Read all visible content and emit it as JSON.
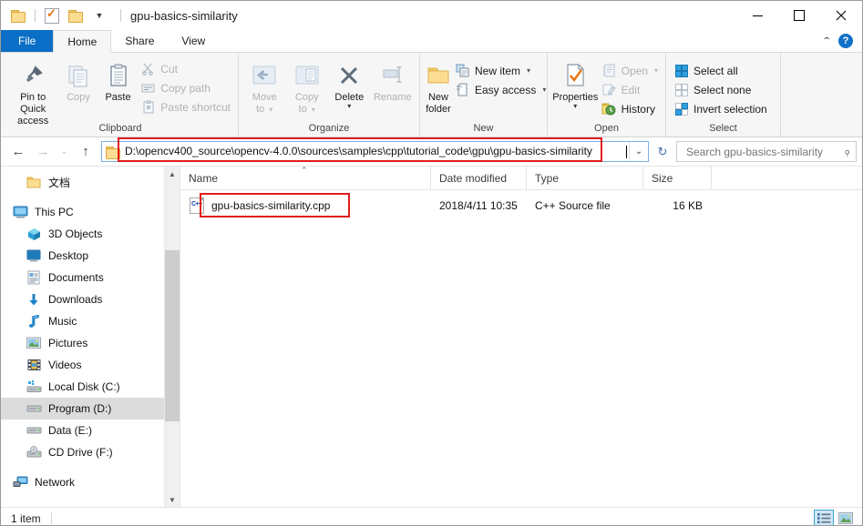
{
  "window": {
    "title": "gpu-basics-similarity",
    "controls": {
      "minimize": "–",
      "maximize": "□",
      "close": "✕"
    }
  },
  "quick_access": {
    "items": [
      "folder-icon",
      "properties-icon",
      "new-folder-icon",
      "customize-caret"
    ]
  },
  "tabs": [
    {
      "label": "File",
      "active": false,
      "type": "file"
    },
    {
      "label": "Home",
      "active": true,
      "type": "normal"
    },
    {
      "label": "Share",
      "active": false,
      "type": "normal"
    },
    {
      "label": "View",
      "active": false,
      "type": "normal"
    }
  ],
  "ribbon": {
    "collapse_icon": "chevron-up-icon",
    "help_icon": "?",
    "groups": [
      {
        "label": "Clipboard",
        "big": [
          {
            "label": "Pin to Quick access",
            "icon": "pin-icon",
            "dim": false
          },
          {
            "label": "Copy",
            "icon": "copy-icon",
            "dim": true
          },
          {
            "label": "Paste",
            "icon": "paste-icon",
            "dim": false
          }
        ],
        "small": [
          {
            "label": "Cut",
            "icon": "scissors-icon",
            "dim": true
          },
          {
            "label": "Copy path",
            "icon": "copy-path-icon",
            "dim": true
          },
          {
            "label": "Paste shortcut",
            "icon": "paste-shortcut-icon",
            "dim": true
          }
        ]
      },
      {
        "label": "Organize",
        "big": [
          {
            "label": "Move to",
            "icon": "move-to-icon",
            "dim": true,
            "caret": true
          },
          {
            "label": "Copy to",
            "icon": "copy-to-icon",
            "dim": true,
            "caret": true
          },
          {
            "label": "Delete",
            "icon": "delete-icon",
            "dim": false,
            "caret": true
          },
          {
            "label": "Rename",
            "icon": "rename-icon",
            "dim": true
          }
        ],
        "small": []
      },
      {
        "label": "New",
        "big": [
          {
            "label": "New folder",
            "icon": "new-folder-icon",
            "dim": false
          }
        ],
        "small": [
          {
            "label": "New item",
            "icon": "new-item-icon",
            "dim": false,
            "caret": true
          },
          {
            "label": "Easy access",
            "icon": "easy-access-icon",
            "dim": false,
            "caret": true
          }
        ]
      },
      {
        "label": "Open",
        "big": [
          {
            "label": "Properties",
            "icon": "properties-icon",
            "dim": false,
            "caret": true
          }
        ],
        "small": [
          {
            "label": "Open",
            "icon": "open-icon",
            "dim": true,
            "caret": true
          },
          {
            "label": "Edit",
            "icon": "edit-icon",
            "dim": true
          },
          {
            "label": "History",
            "icon": "history-icon",
            "dim": false
          }
        ]
      },
      {
        "label": "Select",
        "big": [],
        "small": [
          {
            "label": "Select all",
            "icon": "select-all-icon",
            "dim": false
          },
          {
            "label": "Select none",
            "icon": "select-none-icon",
            "dim": false
          },
          {
            "label": "Invert selection",
            "icon": "invert-selection-icon",
            "dim": false
          }
        ]
      }
    ]
  },
  "address_bar": {
    "back_icon": "←",
    "forward_icon": "→",
    "recent_icon": "⌄",
    "up_icon": "↑",
    "path": "D:\\opencv400_source\\opencv-4.0.0\\sources\\samples\\cpp\\tutorial_code\\gpu\\gpu-basics-similarity",
    "dropdown_icon": "⌄",
    "refresh_icon": "↻"
  },
  "search": {
    "placeholder": "Search gpu-basics-similarity",
    "value": "",
    "icon": "search-icon"
  },
  "sidebar": {
    "items": [
      {
        "label": "文档",
        "icon": "folder-icon",
        "indent": 1,
        "selected": false,
        "gap_after": true
      },
      {
        "label": "This PC",
        "icon": "this-pc-icon",
        "indent": 0,
        "selected": false
      },
      {
        "label": "3D Objects",
        "icon": "3d-objects-icon",
        "indent": 1,
        "selected": false
      },
      {
        "label": "Desktop",
        "icon": "desktop-icon",
        "indent": 1,
        "selected": false
      },
      {
        "label": "Documents",
        "icon": "documents-icon",
        "indent": 1,
        "selected": false
      },
      {
        "label": "Downloads",
        "icon": "downloads-icon",
        "indent": 1,
        "selected": false
      },
      {
        "label": "Music",
        "icon": "music-icon",
        "indent": 1,
        "selected": false
      },
      {
        "label": "Pictures",
        "icon": "pictures-icon",
        "indent": 1,
        "selected": false
      },
      {
        "label": "Videos",
        "icon": "videos-icon",
        "indent": 1,
        "selected": false
      },
      {
        "label": "Local Disk (C:)",
        "icon": "local-disk-icon",
        "indent": 1,
        "selected": false
      },
      {
        "label": "Program (D:)",
        "icon": "drive-icon",
        "indent": 1,
        "selected": true
      },
      {
        "label": "Data (E:)",
        "icon": "drive-icon",
        "indent": 1,
        "selected": false
      },
      {
        "label": "CD Drive (F:)",
        "icon": "cd-drive-icon",
        "indent": 1,
        "selected": false,
        "gap_after": true
      },
      {
        "label": "Network",
        "icon": "network-icon",
        "indent": 0,
        "selected": false
      }
    ]
  },
  "file_list": {
    "columns": [
      "Name",
      "Date modified",
      "Type",
      "Size"
    ],
    "sort_column": "Name",
    "sort_direction": "ascending",
    "rows": [
      {
        "name": "gpu-basics-similarity.cpp",
        "date_modified": "2018/4/11 10:35",
        "type": "C++ Source file",
        "size": "16 KB",
        "icon": "cpp-source-file-icon"
      }
    ]
  },
  "status_bar": {
    "item_count": "1 item",
    "views": [
      {
        "name": "details-view",
        "active": true
      },
      {
        "name": "large-icons-view",
        "active": false
      }
    ]
  },
  "highlights": {
    "accent_red": "#e11b1b",
    "accent_blue": "#0b6ec6"
  }
}
